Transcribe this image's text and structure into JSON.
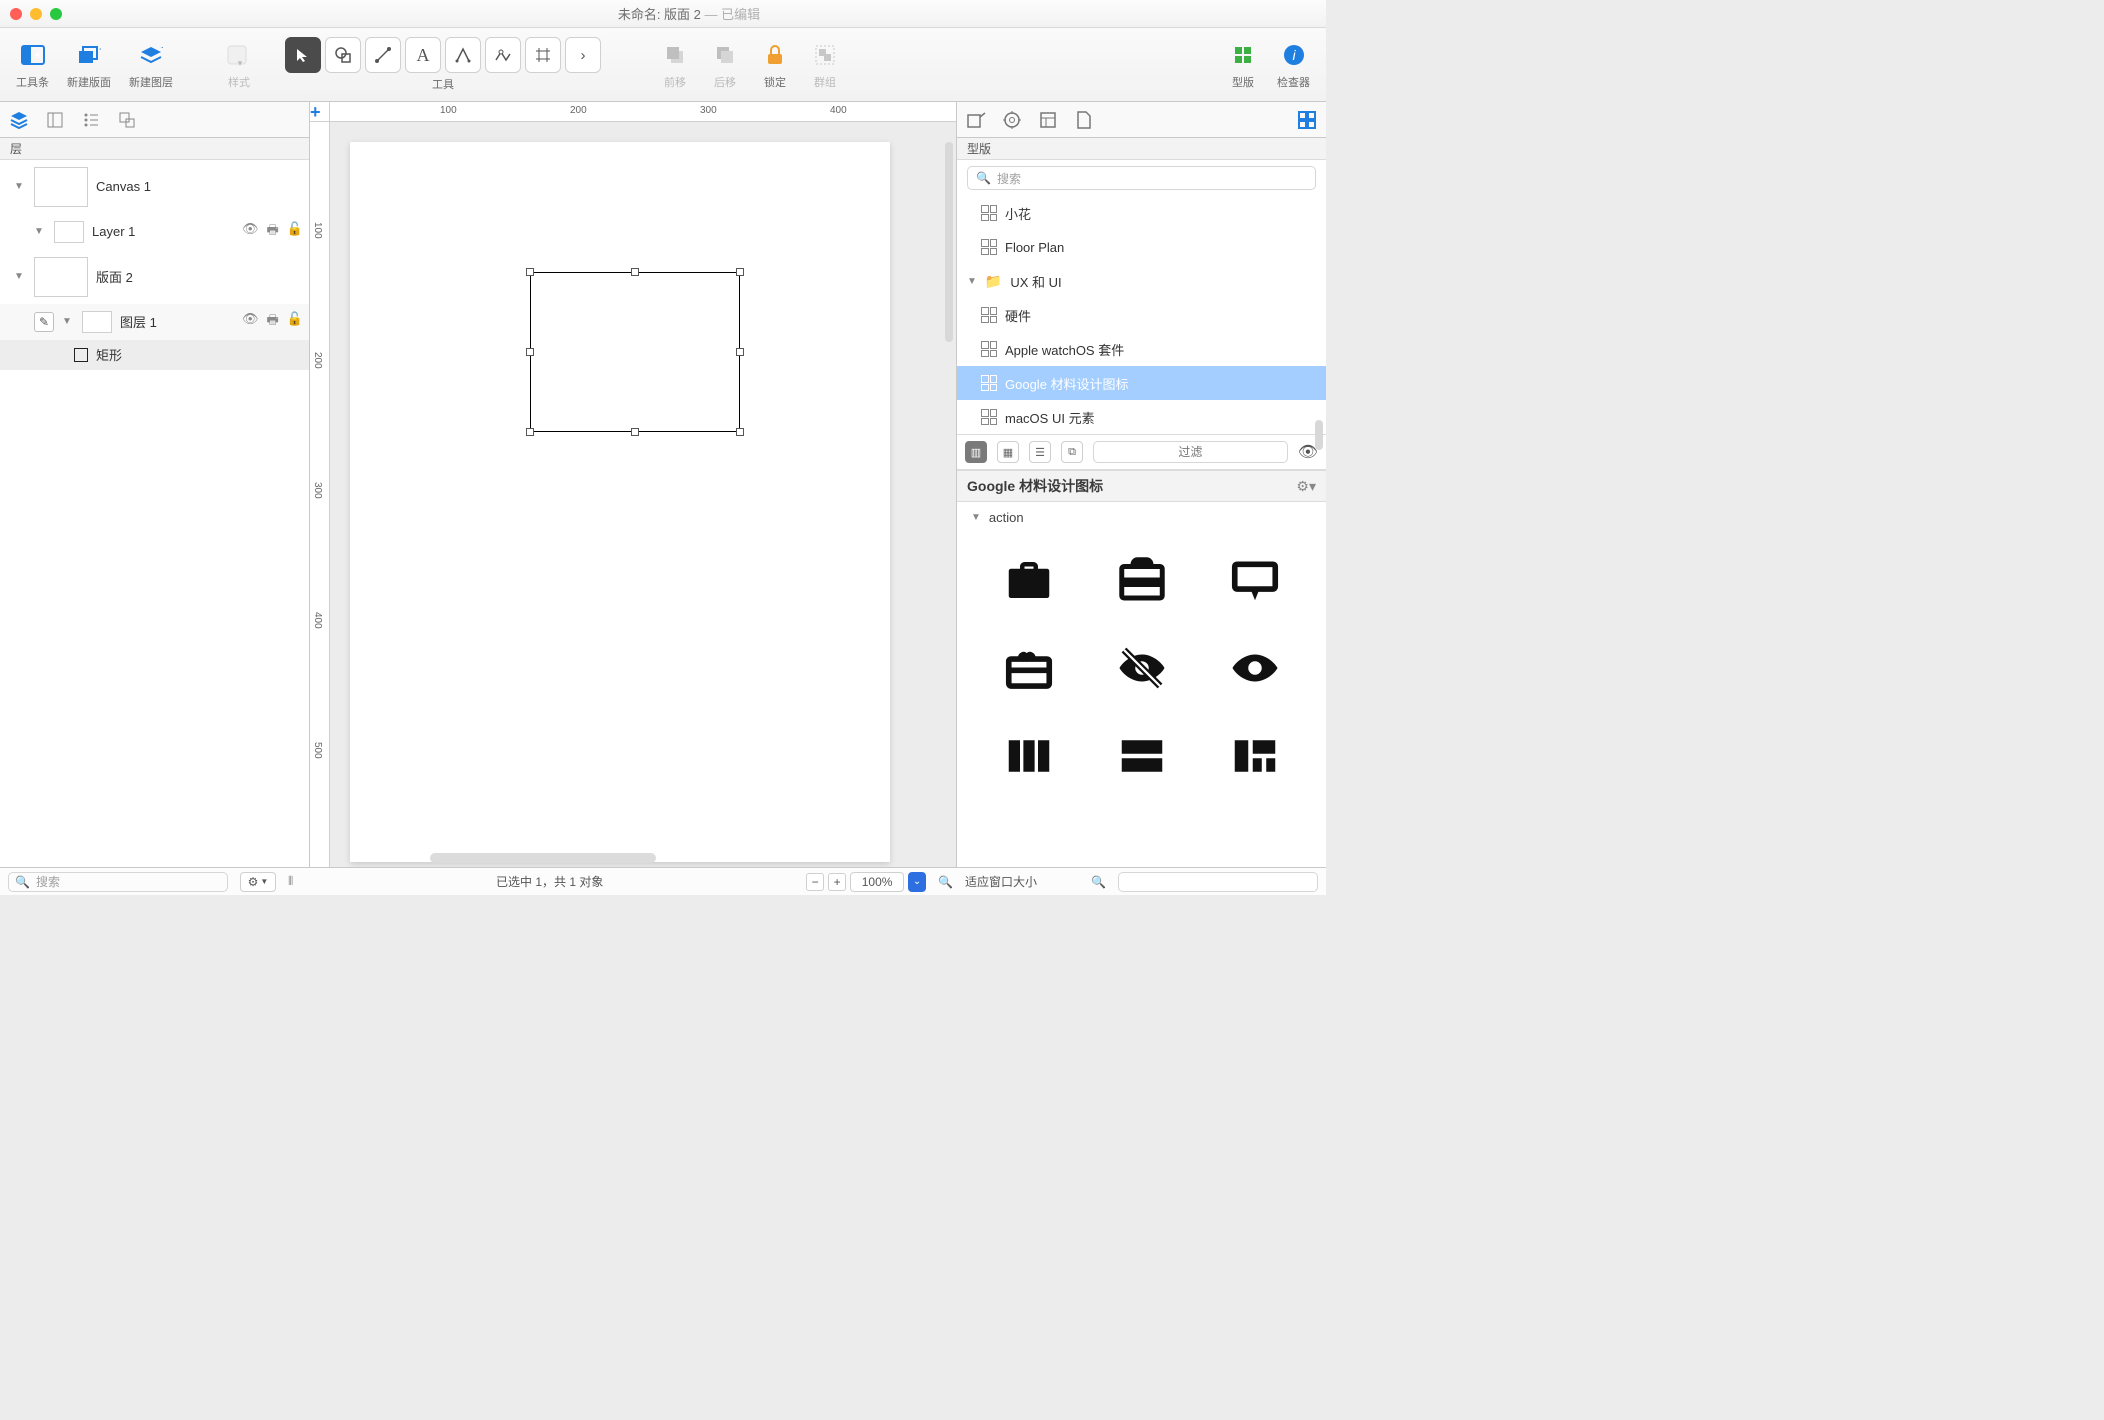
{
  "window": {
    "title_main": "未命名: 版面 2",
    "title_separator": " — ",
    "title_modified": "已编辑"
  },
  "toolbar": {
    "sidebar": "工具条",
    "new_artboard": "新建版面",
    "new_layer": "新建图层",
    "style": "样式",
    "tools": "工具",
    "bring_forward": "前移",
    "send_backward": "后移",
    "lock": "锁定",
    "group": "群组",
    "stencils": "型版",
    "inspector": "检查器"
  },
  "left": {
    "header": "层",
    "canvas1": "Canvas 1",
    "layer1": "Layer 1",
    "artboard2": "版面 2",
    "layer2": "图层 1",
    "shape": "矩形",
    "search_placeholder": "搜索"
  },
  "ruler": {
    "h": [
      "100",
      "200",
      "300",
      "400"
    ],
    "v": [
      "100",
      "200",
      "300",
      "400",
      "500"
    ]
  },
  "right": {
    "header": "型版",
    "search_placeholder": "搜索",
    "items": {
      "flower": "小花",
      "floorplan": "Floor Plan",
      "folder_ux": "UX 和 UI",
      "hardware": "硬件",
      "watchos": "Apple watchOS 套件",
      "material": "Google 材料设计图标",
      "macos": "macOS UI 元素"
    },
    "filter_placeholder": "过滤",
    "section_title": "Google 材料设计图标",
    "category": "action"
  },
  "status": {
    "selection": "已选中 1，共 1 对象",
    "zoom": "100%",
    "fit": "适应窗口大小"
  }
}
